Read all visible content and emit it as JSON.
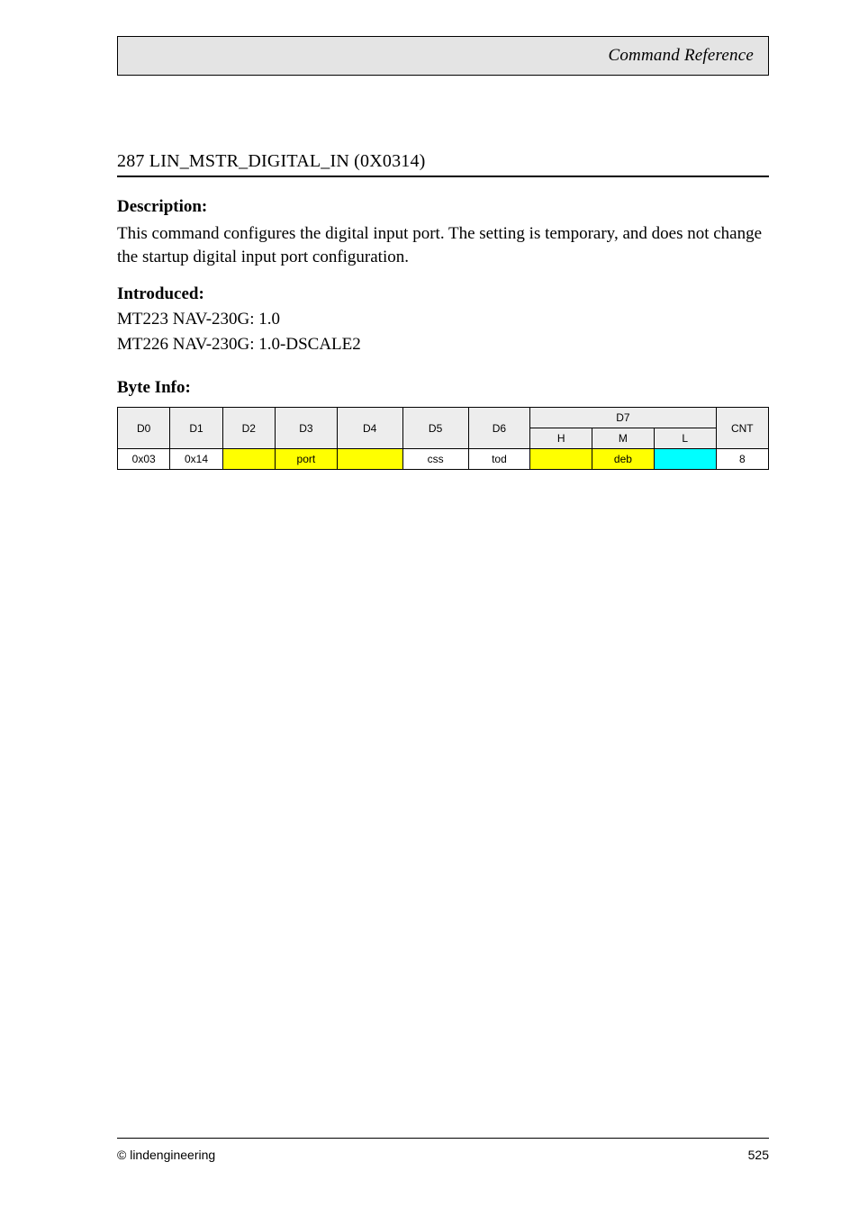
{
  "header": {
    "title": "Command Reference"
  },
  "section": {
    "title": "287 LIN_MSTR_DIGITAL_IN (0X0314)"
  },
  "description": {
    "label": "Description:",
    "text": "This command configures the digital input port. The setting is temporary, and does not change the startup digital input port configuration."
  },
  "introduced": {
    "label": "Introduced:",
    "lines": [
      "MT223 NAV-230G: 1.0",
      "MT226 NAV-230G: 1.0-DSCALE2"
    ]
  },
  "byteinfo": {
    "label": "Byte Info:",
    "headers": [
      "D0",
      "D1",
      "D2",
      "D3",
      "D4",
      "D5",
      "D6",
      "D7",
      "CNT"
    ],
    "subheader": {
      "d7": [
        "H",
        "M",
        "L"
      ]
    },
    "row": {
      "d0": "0x03",
      "d1": "0x14",
      "d2": "",
      "d3": "port",
      "d4": "",
      "d5": "css",
      "d6": "tod",
      "d7h": "",
      "d7m": "deb",
      "d7l": "",
      "cnt": "8"
    },
    "colors": {
      "d2": "c-yellow",
      "d3": "c-yellow",
      "d4": "c-yellow",
      "d7h": "c-yellow",
      "d7m": "c-yellow",
      "d7l": "c-aqua"
    }
  },
  "footer": {
    "left": "© lindengineering",
    "right": "525"
  }
}
